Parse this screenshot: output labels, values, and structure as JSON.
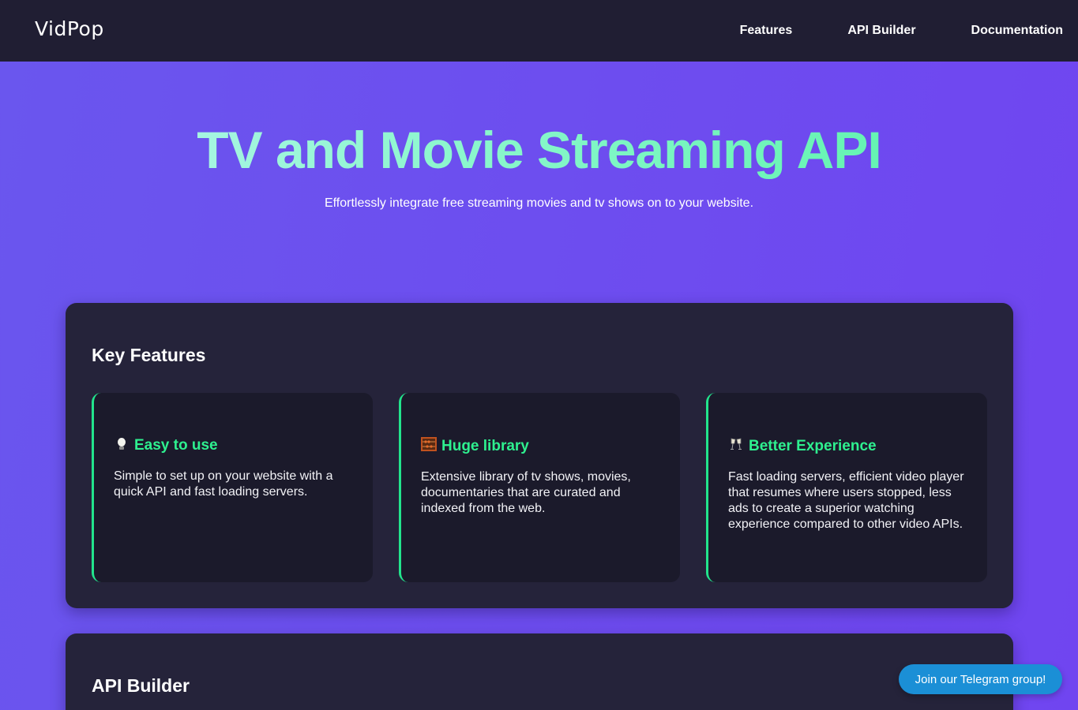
{
  "brand": {
    "logo_text": "VidPop"
  },
  "nav": {
    "items": [
      {
        "label": "Features"
      },
      {
        "label": "API Builder"
      },
      {
        "label": "Documentation"
      }
    ]
  },
  "hero": {
    "title": "TV and Movie Streaming API",
    "subtitle": "Effortlessly integrate free streaming movies and tv shows on to your website."
  },
  "features": {
    "heading": "Key Features",
    "cards": [
      {
        "icon": "lightbulb-icon",
        "title": "Easy to use",
        "text": "Simple to set up on your website with a quick API and fast loading servers."
      },
      {
        "icon": "abacus-icon",
        "title": "Huge library",
        "text": "Extensive library of tv shows, movies, documentaries that are curated and indexed from the web."
      },
      {
        "icon": "clinking-glasses-icon",
        "title": "Better Experience",
        "text": "Fast loading servers, efficient video player that resumes where users stopped, less ads to create a superior watching experience compared to other video APIs."
      }
    ]
  },
  "api_builder": {
    "heading": "API Builder"
  },
  "telegram": {
    "label": "Join our Telegram group!"
  },
  "colors": {
    "accent_green": "#2ef08f",
    "panel_bg": "#25233a",
    "card_bg": "#1b1a2b",
    "telegram_blue": "#1b8fd6"
  }
}
